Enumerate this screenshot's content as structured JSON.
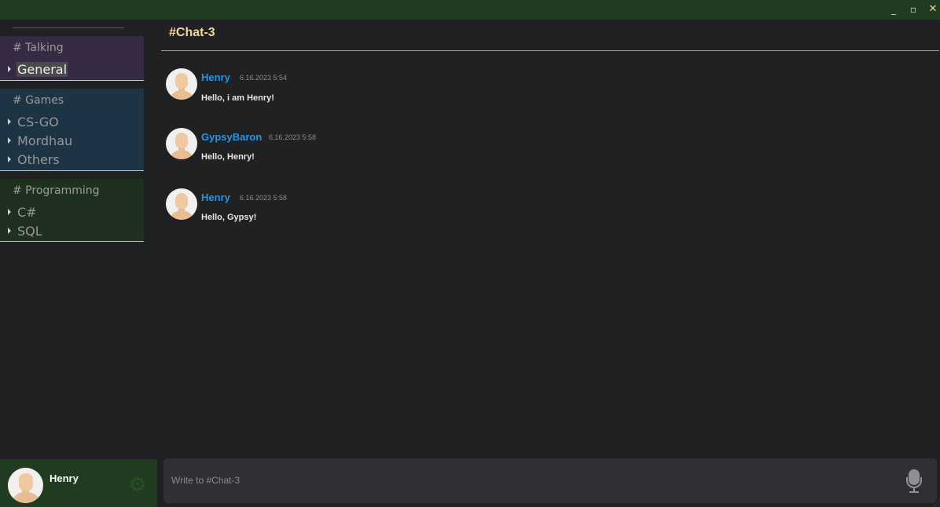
{
  "window": {
    "minimize": "_",
    "maximize": "▫",
    "close": "✕"
  },
  "sidebar": {
    "categories": [
      {
        "title": "# Talking",
        "channels": [
          "General"
        ],
        "selected": "General",
        "color": "#362a44"
      },
      {
        "title": "# Games",
        "channels": [
          "CS-GO",
          "Mordhau",
          "Others"
        ],
        "color": "#1d3444"
      },
      {
        "title": "# Programming",
        "channels": [
          "C#",
          "SQL"
        ],
        "color": "#1f2f20"
      }
    ]
  },
  "user": {
    "name": "Henry",
    "settings_icon": "gear-icon"
  },
  "chat": {
    "title": "#Chat-3",
    "messages": [
      {
        "author": "Henry",
        "time": "6.16.2023 5:54",
        "text": "Hello, i am Henry!"
      },
      {
        "author": "GypsyBaron",
        "time": "6.16.2023 5:58",
        "text": "Hello, Henry!"
      },
      {
        "author": "Henry",
        "time": "6.16.2023 5:58",
        "text": "Hello, Gypsy!"
      }
    ]
  },
  "composer": {
    "placeholder": "Write to #Chat-3",
    "value": "",
    "mic_icon": "microphone-icon"
  },
  "colors": {
    "titlebar": "#213b20",
    "author": "#2b93e3",
    "chat_title": "#f0d79c",
    "background": "#202122"
  }
}
